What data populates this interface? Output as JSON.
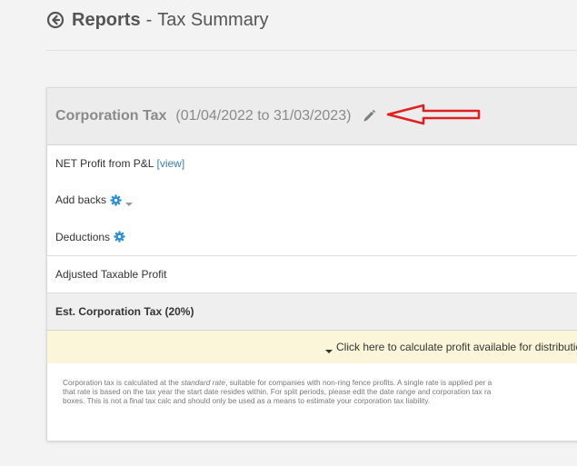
{
  "header": {
    "section": "Reports",
    "separator": "-",
    "page": "Tax Summary"
  },
  "panel": {
    "title": "Corporation Tax",
    "period": "(01/04/2022 to 31/03/2023)",
    "rows": {
      "net_profit_label": "NET Profit from P&L",
      "net_profit_link": "[view]",
      "add_backs_label": "Add backs",
      "deductions_label": "Deductions",
      "adjusted_label": "Adjusted Taxable Profit",
      "est_label": "Est. Corporation Tax (20%)"
    },
    "banner_text": "Click here to calculate profit available for distributio",
    "footnote": {
      "line1_pre": "Corporation tax is calculated at the ",
      "line1_em": "standard rate",
      "line1_post": ", suitable for companies with non-ring fence profits. A single rate is applied per a",
      "line2": "that rate is based on the tax year the start date resides within. For split periods, please edit the date range and corporation tax ra",
      "line3": "boxes. This is not a final tax calc and should only be used as a means to estimate your corporation tax liability."
    }
  },
  "colors": {
    "link": "#3a7fb8",
    "gear": "#2d8fd6",
    "annotation_arrow": "#e02020",
    "banner_bg": "#fbf6d9"
  },
  "icons": [
    "back-circle-icon",
    "pencil-icon",
    "gear-icon",
    "caret-down-icon",
    "red-arrow-annotation"
  ]
}
